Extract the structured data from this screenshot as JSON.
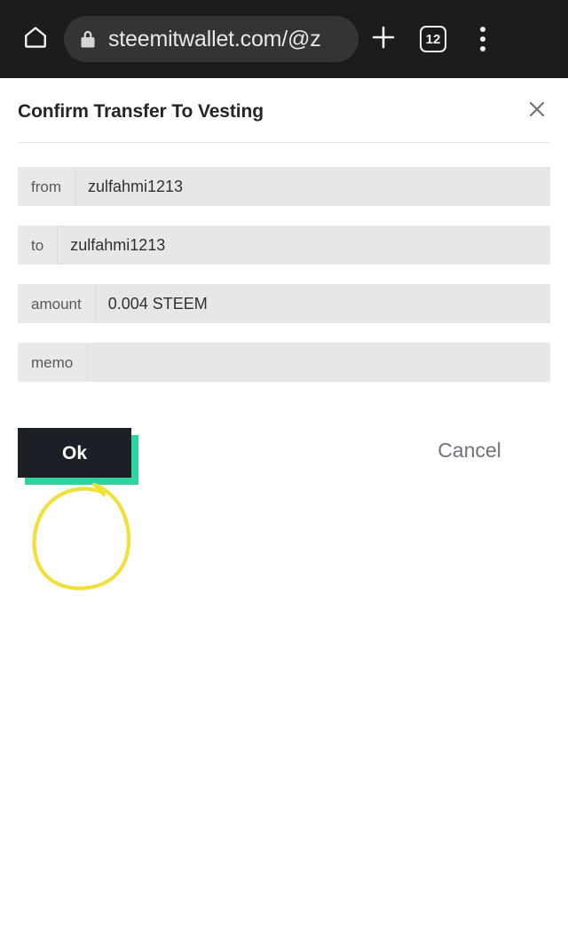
{
  "browser": {
    "home_icon": "home-icon",
    "lock_icon": "lock-icon",
    "url": "steemitwallet.com/@z",
    "new_tab_icon": "plus-icon",
    "tab_count": "12",
    "menu_icon": "kebab-menu-icon"
  },
  "dialog": {
    "title": "Confirm Transfer To Vesting",
    "close_icon": "close-icon",
    "rows": [
      {
        "label": "from",
        "value": "zulfahmi1213"
      },
      {
        "label": "to",
        "value": "zulfahmi1213"
      },
      {
        "label": "amount",
        "value": "0.004 STEEM"
      },
      {
        "label": "memo",
        "value": ""
      }
    ],
    "confirm_label": "Ok",
    "cancel_label": "Cancel"
  },
  "annotation": {
    "shape": "hand-drawn-circle",
    "target": "Ok",
    "color": "#f2e03a"
  },
  "colors": {
    "chrome_background": "#1c1c1c",
    "omnibox_background": "#333434",
    "button_primary": "#1a2026",
    "button_shadow_accent": "#2cd5a0",
    "field_background": "#e7e7e7",
    "label_background": "#e9e9e9",
    "title_text": "#232628",
    "cancel_text": "#70757a",
    "annotation": "#f2e03a"
  }
}
